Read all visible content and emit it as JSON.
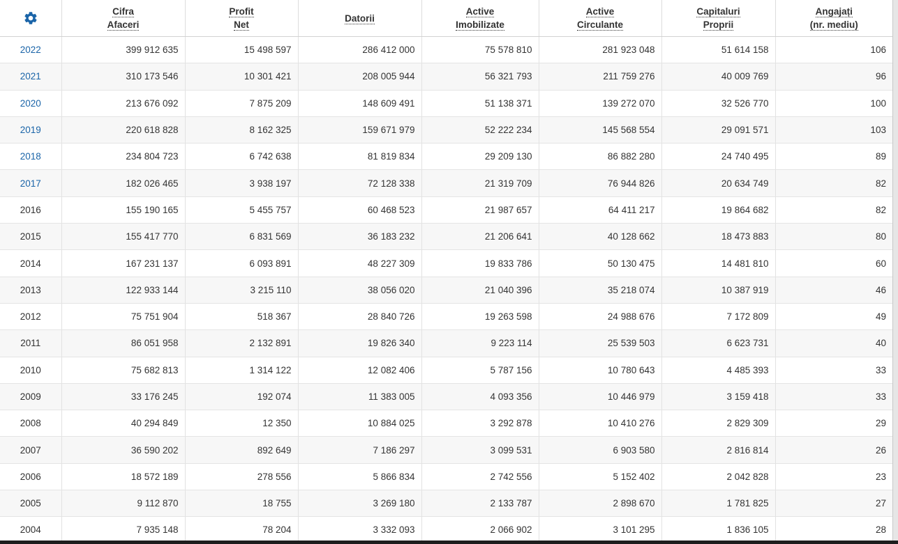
{
  "table": {
    "settings_icon": "gear-icon",
    "accent_color": "#1a64a8",
    "headers": [
      [
        "Cifra",
        "Afaceri"
      ],
      [
        "Profit",
        "Net"
      ],
      [
        "Datorii"
      ],
      [
        "Active",
        "Imobilizate"
      ],
      [
        "Active",
        "Circulante"
      ],
      [
        "Capitaluri",
        "Proprii"
      ],
      [
        "Angajați",
        "(nr. mediu)"
      ]
    ],
    "rows": [
      {
        "year": "2022",
        "link": true,
        "values": [
          "399 912 635",
          "15 498 597",
          "286 412 000",
          "75 578 810",
          "281 923 048",
          "51 614 158",
          "106"
        ]
      },
      {
        "year": "2021",
        "link": true,
        "values": [
          "310 173 546",
          "10 301 421",
          "208 005 944",
          "56 321 793",
          "211 759 276",
          "40 009 769",
          "96"
        ]
      },
      {
        "year": "2020",
        "link": true,
        "values": [
          "213 676 092",
          "7 875 209",
          "148 609 491",
          "51 138 371",
          "139 272 070",
          "32 526 770",
          "100"
        ]
      },
      {
        "year": "2019",
        "link": true,
        "values": [
          "220 618 828",
          "8 162 325",
          "159 671 979",
          "52 222 234",
          "145 568 554",
          "29 091 571",
          "103"
        ]
      },
      {
        "year": "2018",
        "link": true,
        "values": [
          "234 804 723",
          "6 742 638",
          "81 819 834",
          "29 209 130",
          "86 882 280",
          "24 740 495",
          "89"
        ]
      },
      {
        "year": "2017",
        "link": true,
        "values": [
          "182 026 465",
          "3 938 197",
          "72 128 338",
          "21 319 709",
          "76 944 826",
          "20 634 749",
          "82"
        ]
      },
      {
        "year": "2016",
        "link": false,
        "values": [
          "155 190 165",
          "5 455 757",
          "60 468 523",
          "21 987 657",
          "64 411 217",
          "19 864 682",
          "82"
        ]
      },
      {
        "year": "2015",
        "link": false,
        "values": [
          "155 417 770",
          "6 831 569",
          "36 183 232",
          "21 206 641",
          "40 128 662",
          "18 473 883",
          "80"
        ]
      },
      {
        "year": "2014",
        "link": false,
        "values": [
          "167 231 137",
          "6 093 891",
          "48 227 309",
          "19 833 786",
          "50 130 475",
          "14 481 810",
          "60"
        ]
      },
      {
        "year": "2013",
        "link": false,
        "values": [
          "122 933 144",
          "3 215 110",
          "38 056 020",
          "21 040 396",
          "35 218 074",
          "10 387 919",
          "46"
        ]
      },
      {
        "year": "2012",
        "link": false,
        "values": [
          "75 751 904",
          "518 367",
          "28 840 726",
          "19 263 598",
          "24 988 676",
          "7 172 809",
          "49"
        ]
      },
      {
        "year": "2011",
        "link": false,
        "values": [
          "86 051 958",
          "2 132 891",
          "19 826 340",
          "9 223 114",
          "25 539 503",
          "6 623 731",
          "40"
        ]
      },
      {
        "year": "2010",
        "link": false,
        "values": [
          "75 682 813",
          "1 314 122",
          "12 082 406",
          "5 787 156",
          "10 780 643",
          "4 485 393",
          "33"
        ]
      },
      {
        "year": "2009",
        "link": false,
        "values": [
          "33 176 245",
          "192 074",
          "11 383 005",
          "4 093 356",
          "10 446 979",
          "3 159 418",
          "33"
        ]
      },
      {
        "year": "2008",
        "link": false,
        "values": [
          "40 294 849",
          "12 350",
          "10 884 025",
          "3 292 878",
          "10 410 276",
          "2 829 309",
          "29"
        ]
      },
      {
        "year": "2007",
        "link": false,
        "values": [
          "36 590 202",
          "892 649",
          "7 186 297",
          "3 099 531",
          "6 903 580",
          "2 816 814",
          "26"
        ]
      },
      {
        "year": "2006",
        "link": false,
        "values": [
          "18 572 189",
          "278 556",
          "5 866 834",
          "2 742 556",
          "5 152 402",
          "2 042 828",
          "23"
        ]
      },
      {
        "year": "2005",
        "link": false,
        "values": [
          "9 112 870",
          "18 755",
          "3 269 180",
          "2 133 787",
          "2 898 670",
          "1 781 825",
          "27"
        ]
      },
      {
        "year": "2004",
        "link": false,
        "values": [
          "7 935 148",
          "78 204",
          "3 332 093",
          "2 066 902",
          "3 101 295",
          "1 836 105",
          "28"
        ]
      }
    ]
  }
}
